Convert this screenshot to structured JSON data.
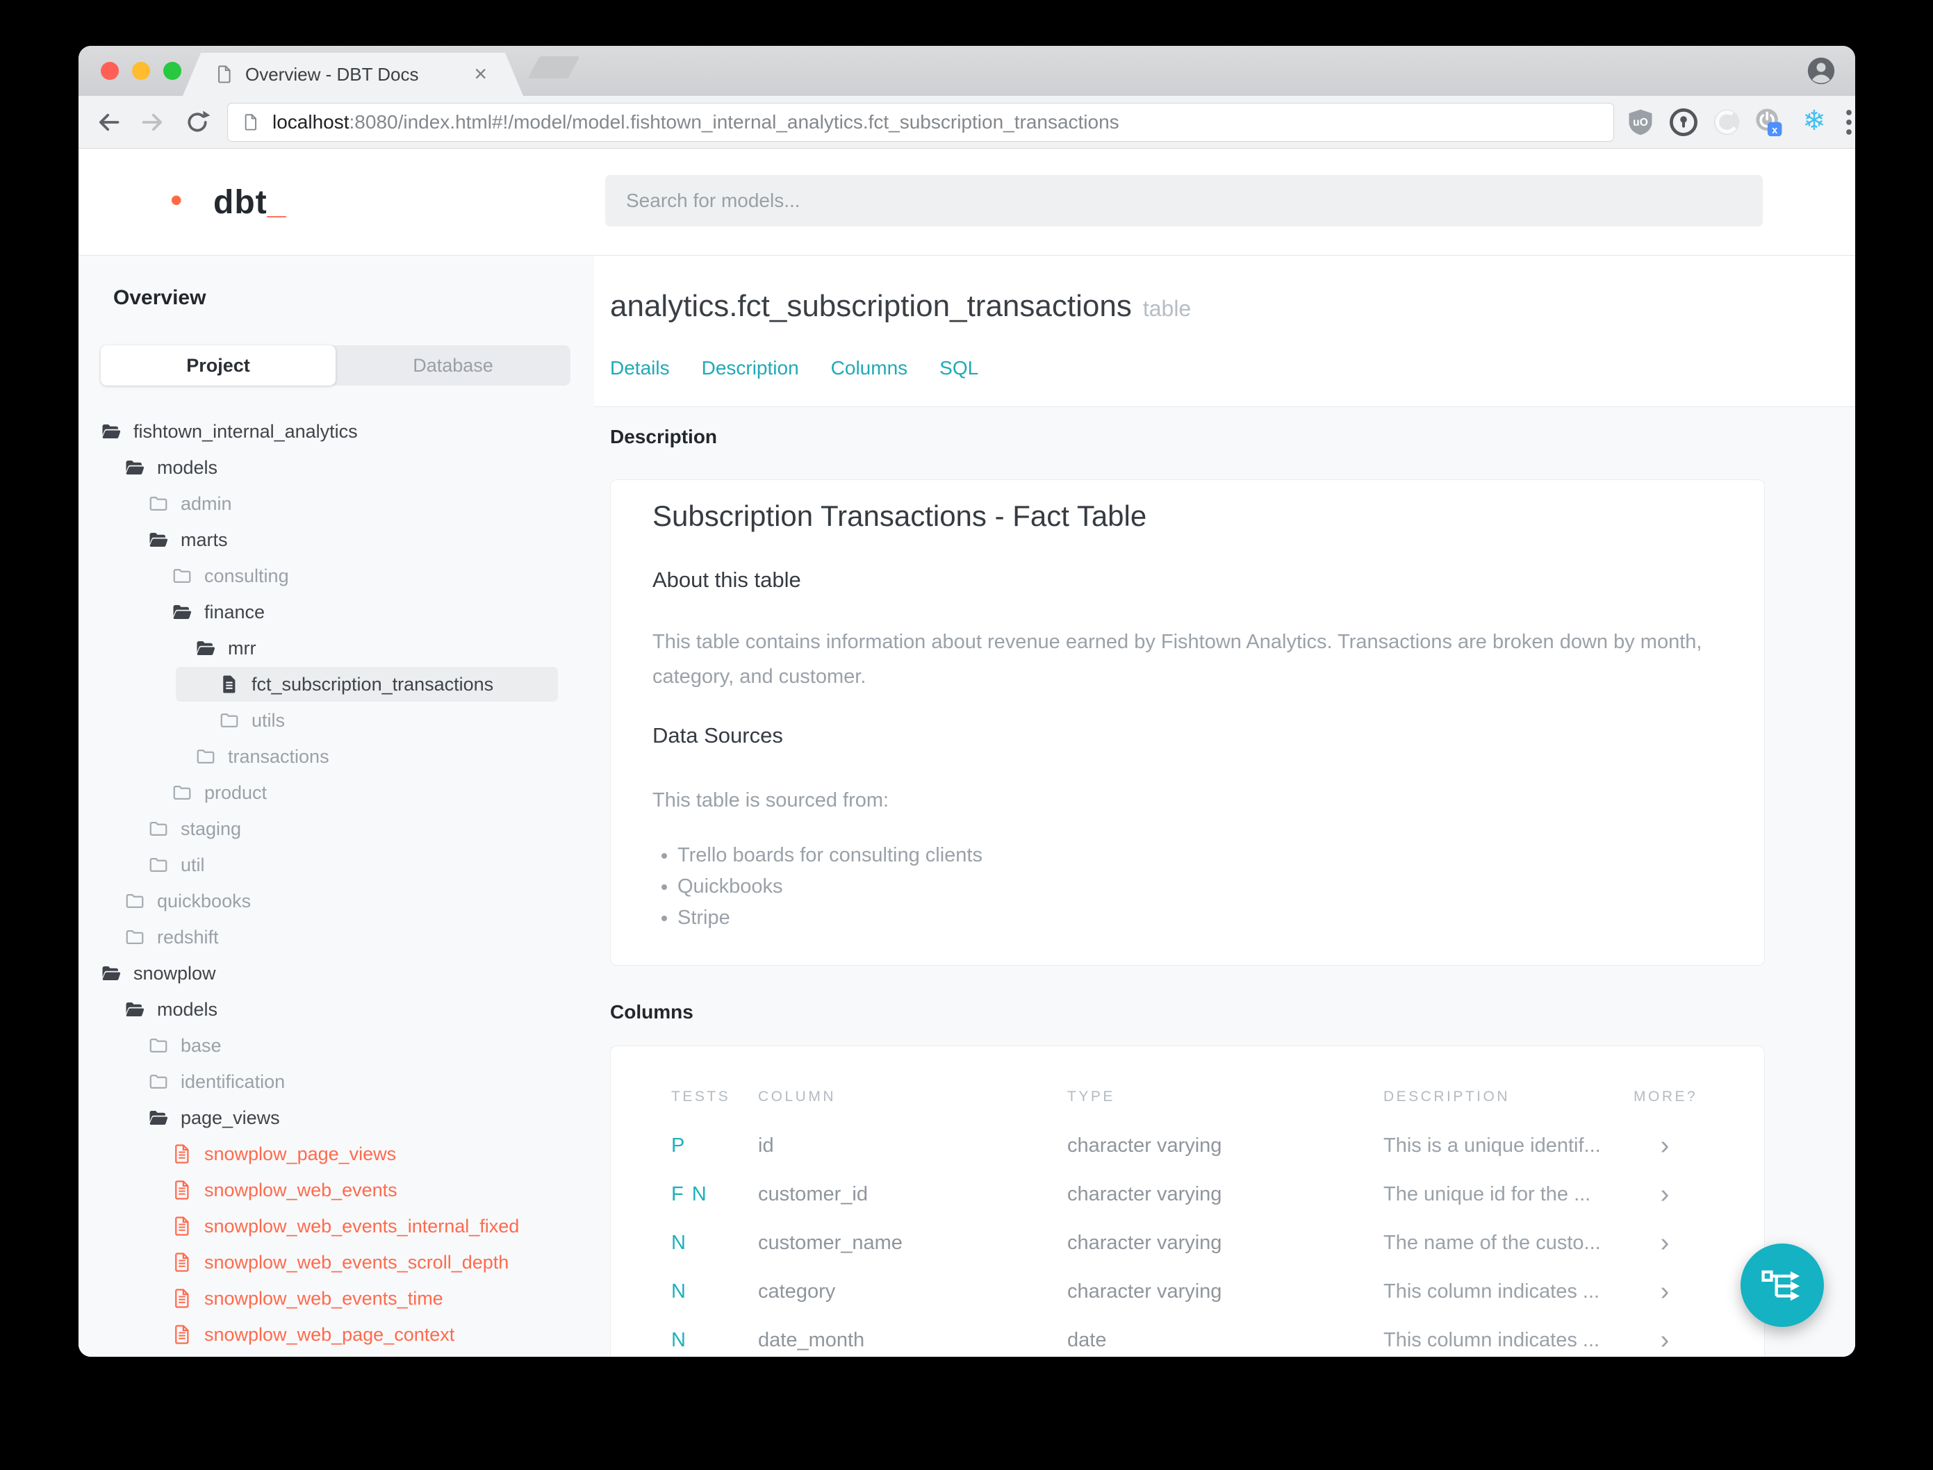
{
  "browser": {
    "tab_title": "Overview - DBT Docs",
    "tab_close": "×",
    "url_host": "localhost",
    "url_rest": ":8080/index.html#!/model/model.fishtown_internal_analytics.fct_subscription_transactions",
    "icons": {
      "ublock_text": "uO",
      "power_badge": "x",
      "snowflake_glyph": "❄"
    }
  },
  "header": {
    "logo_text": "dbt",
    "logo_underscore": "_",
    "search_placeholder": "Search for models..."
  },
  "sidebar": {
    "title": "Overview",
    "tabs": {
      "project": "Project",
      "database": "Database"
    },
    "tree": [
      {
        "label": "fishtown_internal_analytics",
        "icon": "folder-open-icon"
      },
      {
        "label": "models",
        "icon": "folder-open-icon"
      },
      {
        "label": "admin",
        "icon": "folder-icon"
      },
      {
        "label": "marts",
        "icon": "folder-open-icon"
      },
      {
        "label": "consulting",
        "icon": "folder-icon"
      },
      {
        "label": "finance",
        "icon": "folder-open-icon"
      },
      {
        "label": "mrr",
        "icon": "folder-open-icon"
      },
      {
        "label": "fct_subscription_transactions",
        "icon": "model-file-icon"
      },
      {
        "label": "utils",
        "icon": "folder-icon"
      },
      {
        "label": "transactions",
        "icon": "folder-icon"
      },
      {
        "label": "product",
        "icon": "folder-icon"
      },
      {
        "label": "staging",
        "icon": "folder-icon"
      },
      {
        "label": "util",
        "icon": "folder-icon"
      },
      {
        "label": "quickbooks",
        "icon": "folder-icon"
      },
      {
        "label": "redshift",
        "icon": "folder-icon"
      },
      {
        "label": "snowplow",
        "icon": "folder-open-icon"
      },
      {
        "label": "models",
        "icon": "folder-open-icon"
      },
      {
        "label": "base",
        "icon": "folder-icon"
      },
      {
        "label": "identification",
        "icon": "folder-icon"
      },
      {
        "label": "page_views",
        "icon": "folder-open-icon"
      },
      {
        "label": "snowplow_page_views",
        "icon": "model-file-icon"
      },
      {
        "label": "snowplow_web_events",
        "icon": "model-file-icon"
      },
      {
        "label": "snowplow_web_events_internal_fixed",
        "icon": "model-file-icon"
      },
      {
        "label": "snowplow_web_events_scroll_depth",
        "icon": "model-file-icon"
      },
      {
        "label": "snowplow_web_events_time",
        "icon": "model-file-icon"
      },
      {
        "label": "snowplow_web_page_context",
        "icon": "model-file-icon"
      }
    ]
  },
  "main": {
    "title": "analytics.fct_subscription_transactions",
    "title_suffix": "table",
    "nav": {
      "0": "Details",
      "1": "Description",
      "2": "Columns",
      "3": "SQL"
    },
    "description": {
      "section_label": "Description",
      "heading": "Subscription Transactions - Fact Table",
      "about_heading": "About this table",
      "about_text": "This table contains information about revenue earned by Fishtown Analytics. Transactions are broken down by month, category, and customer.",
      "sources_heading": "Data Sources",
      "sources_intro": "This table is sourced from:",
      "sources": {
        "0": "Trello boards for consulting clients",
        "1": "Quickbooks",
        "2": "Stripe"
      }
    },
    "columns": {
      "section_label": "Columns",
      "headers": {
        "0": "TESTS",
        "1": "COLUMN",
        "2": "TYPE",
        "3": "DESCRIPTION",
        "4": "MORE?"
      },
      "rows": [
        {
          "tests": "P",
          "column": "id",
          "type": "character varying",
          "description": "This is a unique identif...",
          "more": "›"
        },
        {
          "tests": "F N",
          "column": "customer_id",
          "type": "character varying",
          "description": "The unique id for the ...",
          "more": "›"
        },
        {
          "tests": "N",
          "column": "customer_name",
          "type": "character varying",
          "description": "The name of the custo...",
          "more": "›"
        },
        {
          "tests": "N",
          "column": "category",
          "type": "character varying",
          "description": "This column indicates ...",
          "more": "›"
        },
        {
          "tests": "N",
          "column": "date_month",
          "type": "date",
          "description": "This column indicates ...",
          "more": "›"
        }
      ]
    }
  },
  "colors": {
    "accent_teal": "#14b2c2",
    "link_teal": "#1fa9b7",
    "brand_orange": "#ff6a4d",
    "panel_gray": "#f8f9fa"
  }
}
